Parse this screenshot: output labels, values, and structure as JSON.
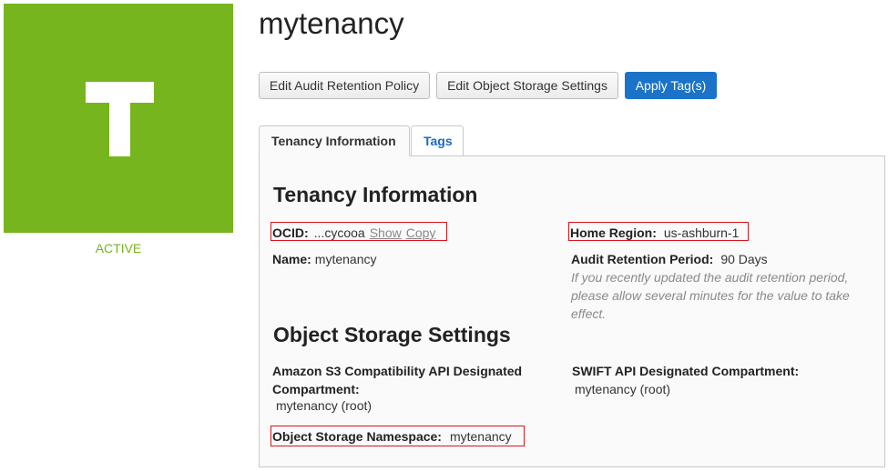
{
  "tenancy": {
    "icon_letter": "T",
    "status": "ACTIVE",
    "name": "mytenancy"
  },
  "actions": {
    "edit_audit": "Edit Audit Retention Policy",
    "edit_storage": "Edit Object Storage Settings",
    "apply_tags": "Apply Tag(s)"
  },
  "tabs": [
    {
      "label": "Tenancy Information",
      "selected": true
    },
    {
      "label": "Tags",
      "selected": false
    }
  ],
  "tenancy_info": {
    "heading": "Tenancy Information",
    "ocid_label": "OCID:",
    "ocid_value": "...cycooa",
    "ocid_show": "Show",
    "ocid_copy": "Copy",
    "home_region_label": "Home Region:",
    "home_region_value": "us-ashburn-1",
    "name_label": "Name:",
    "name_value": "mytenancy",
    "audit_label": "Audit Retention Period:",
    "audit_value": "90 Days",
    "audit_note": "If you recently updated the audit retention period, please allow several minutes for the value to take effect."
  },
  "object_storage": {
    "heading": "Object Storage Settings",
    "s3_label": "Amazon S3 Compatibility API Designated Compartment:",
    "s3_value": "mytenancy (root)",
    "swift_label": "SWIFT API Designated Compartment:",
    "swift_value": "mytenancy (root)",
    "namespace_label": "Object Storage Namespace:",
    "namespace_value": "mytenancy"
  },
  "colors": {
    "tile": "#76b51d",
    "primary": "#1a73c9",
    "highlight_box": "#d9141c"
  }
}
